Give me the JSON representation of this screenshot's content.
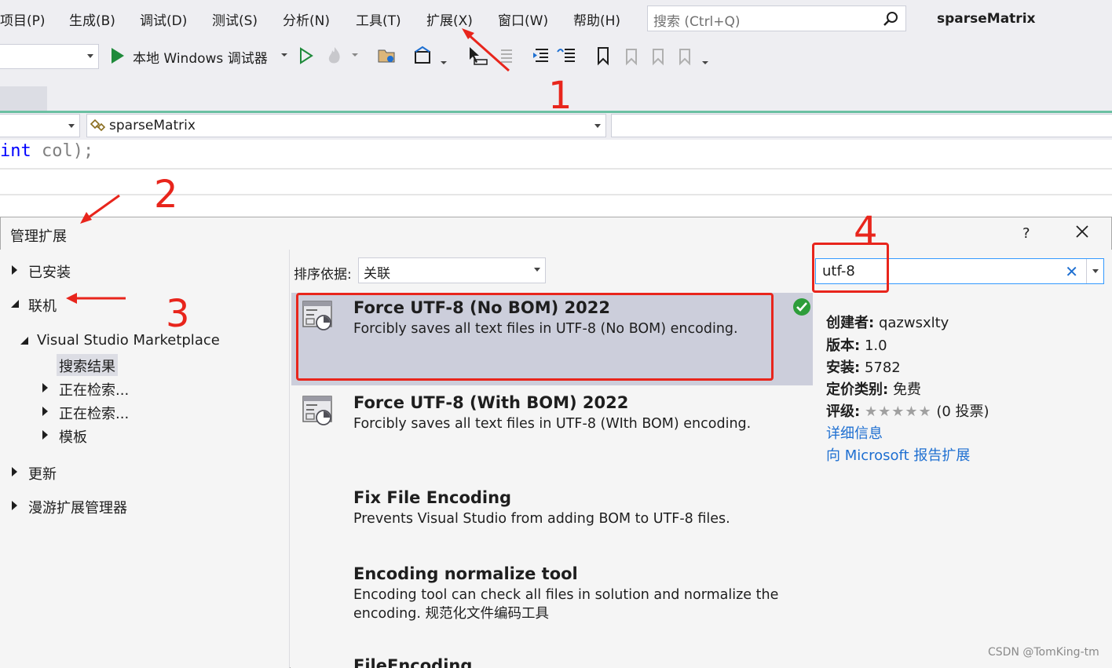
{
  "menu": {
    "items": [
      "项目(P)",
      "生成(B)",
      "调试(D)",
      "测试(S)",
      "分析(N)",
      "工具(T)",
      "扩展(X)",
      "窗口(W)",
      "帮助(H)"
    ],
    "search_placeholder": "搜索 (Ctrl+Q)",
    "solution_name": "sparseMatrix"
  },
  "toolbar": {
    "debug_target": "本地 Windows 调试器"
  },
  "navbar": {
    "member": "sparseMatrix"
  },
  "code": {
    "keyword": "int",
    "rest": " col);"
  },
  "dialog": {
    "title": "管理扩展",
    "help": "?",
    "tree": {
      "installed": "已安装",
      "online": "联机",
      "marketplace": "Visual Studio Marketplace",
      "search_results": "搜索结果",
      "searching_1": "正在检索...",
      "searching_2": "正在检索...",
      "templates": "模板",
      "updates": "更新",
      "roaming": "漫游扩展管理器"
    },
    "sort_label": "排序依据:",
    "sort_value": "关联",
    "search_value": "utf-8",
    "extensions": [
      {
        "title": "Force UTF-8 (No BOM) 2022",
        "desc": "Forcibly saves all text files in UTF-8 (No BOM) encoding."
      },
      {
        "title": "Force UTF-8 (With BOM) 2022",
        "desc": "Forcibly saves all text files in UTF-8 (WIth BOM) encoding."
      },
      {
        "title": "Fix File Encoding",
        "desc": "Prevents Visual Studio from adding BOM to UTF-8 files."
      },
      {
        "title": "Encoding normalize tool",
        "desc": "Encoding tool can check all files in solution and normalize the encoding. 规范化文件编码工具"
      },
      {
        "title": "FileEncoding",
        "desc": ""
      }
    ],
    "details": {
      "creator_key": "创建者:",
      "creator": "qazwsxlty",
      "version_key": "版本:",
      "version": "1.0",
      "installs_key": "安装:",
      "installs": "5782",
      "pricing_key": "定价类别:",
      "pricing": "免费",
      "rating_key": "评级:",
      "stars": "★★★★★",
      "votes": "(0 投票)",
      "more_info": "详细信息",
      "report": "向 Microsoft 报告扩展"
    }
  },
  "annotations": [
    "1",
    "2",
    "3",
    "4"
  ],
  "watermark": "CSDN @TomKing-tm",
  "colors": {
    "annotation_red": "#e8251c",
    "link_blue": "#1e6fd1",
    "selected_row": "#cccedb",
    "run_green": "#1f8a3b"
  }
}
